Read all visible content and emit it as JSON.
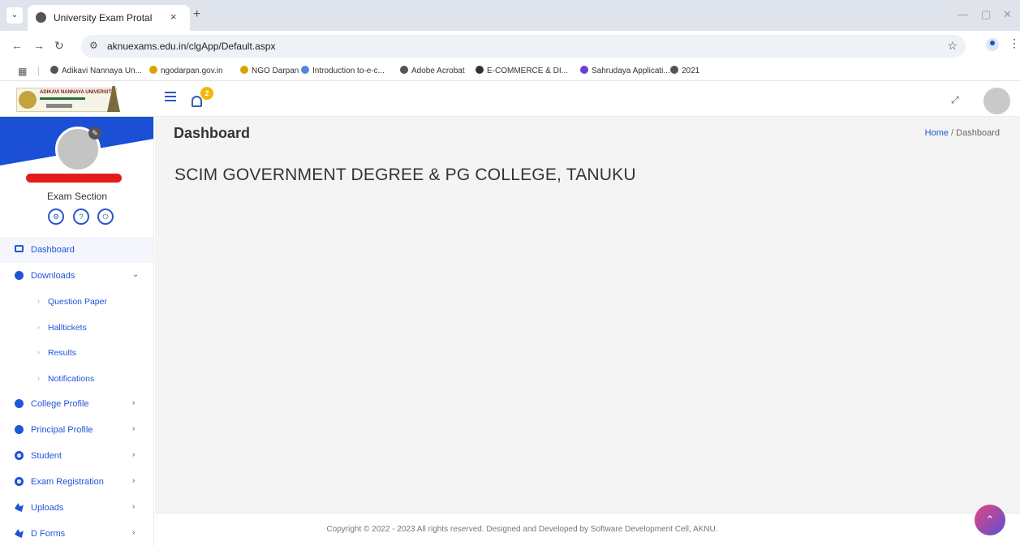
{
  "browser": {
    "tab_title": "University Exam Protal",
    "tab_close": "×",
    "new_tab": "+",
    "url": "aknuexams.edu.in/clgApp/Default.aspx",
    "bookmarks": [
      {
        "label": "Adikavi Nannaya Un...",
        "color": "#555555"
      },
      {
        "label": "ngodarpan.gov.in",
        "color": "#d8a400"
      },
      {
        "label": "NGO Darpan",
        "color": "#d8a400"
      },
      {
        "label": "Introduction to-e-c...",
        "color": "#4f8ad9"
      },
      {
        "label": "Adobe Acrobat",
        "color": "#555555"
      },
      {
        "label": "E-COMMERCE & DI...",
        "color": "#333333"
      },
      {
        "label": "Sahrudaya Applicati...",
        "color": "#6b3fd6"
      },
      {
        "label": "2021",
        "color": "#555555"
      }
    ]
  },
  "header": {
    "logo_text": "ADIKAVI NANNAYA UNIVERSITY",
    "notification_count": "2"
  },
  "sidebar": {
    "role": "Exam Section",
    "items": [
      {
        "label": "Dashboard",
        "icon": "monitor-icon"
      },
      {
        "label": "Downloads",
        "icon": "pie-icon"
      },
      {
        "label": "College Profile",
        "icon": "pie-icon"
      },
      {
        "label": "Principal Profile",
        "icon": "pie-icon"
      },
      {
        "label": "Student",
        "icon": "circle-icon"
      },
      {
        "label": "Exam Registration",
        "icon": "circle-icon"
      },
      {
        "label": "Uploads",
        "icon": "share-icon"
      },
      {
        "label": "D Forms",
        "icon": "share-icon"
      }
    ],
    "downloads_sub": [
      "Question Paper",
      "Halltickets",
      "Results",
      "Notifications"
    ]
  },
  "main": {
    "title": "Dashboard",
    "breadcrumb_home": "Home",
    "breadcrumb_sep": " / ",
    "breadcrumb_current": "Dashboard",
    "college_name": "SCIM GOVERNMENT DEGREE & PG COLLEGE, TANUKU"
  },
  "footer": {
    "text": "Copyright © 2022 - 2023 All rights reserved. Designed and Developed by Software Development Cell, AKNU."
  }
}
